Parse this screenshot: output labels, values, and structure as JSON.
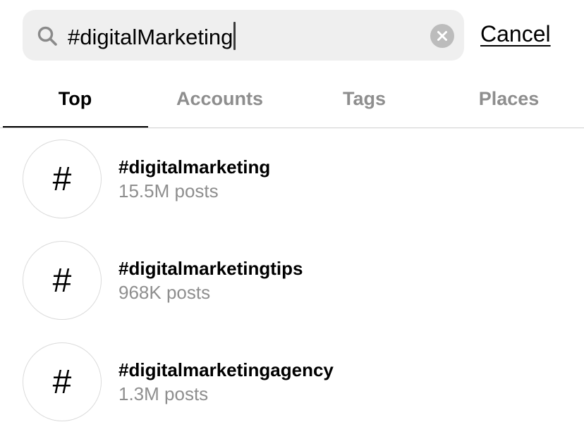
{
  "search": {
    "value": "#digitalMarketing",
    "search_icon": "search-icon",
    "clear_icon": "clear-icon",
    "cancel_label": "Cancel"
  },
  "tabs": [
    {
      "label": "Top",
      "active": true
    },
    {
      "label": "Accounts",
      "active": false
    },
    {
      "label": "Tags",
      "active": false
    },
    {
      "label": "Places",
      "active": false
    }
  ],
  "results": [
    {
      "icon": "#",
      "title": "#digitalmarketing",
      "subtitle": "15.5M posts"
    },
    {
      "icon": "#",
      "title": "#digitalmarketingtips",
      "subtitle": "968K posts"
    },
    {
      "icon": "#",
      "title": "#digitalmarketingagency",
      "subtitle": "1.3M posts"
    }
  ],
  "colors": {
    "search_bg": "#efefef",
    "secondary_text": "#8e8e8e",
    "divider": "#cfcfcf"
  }
}
